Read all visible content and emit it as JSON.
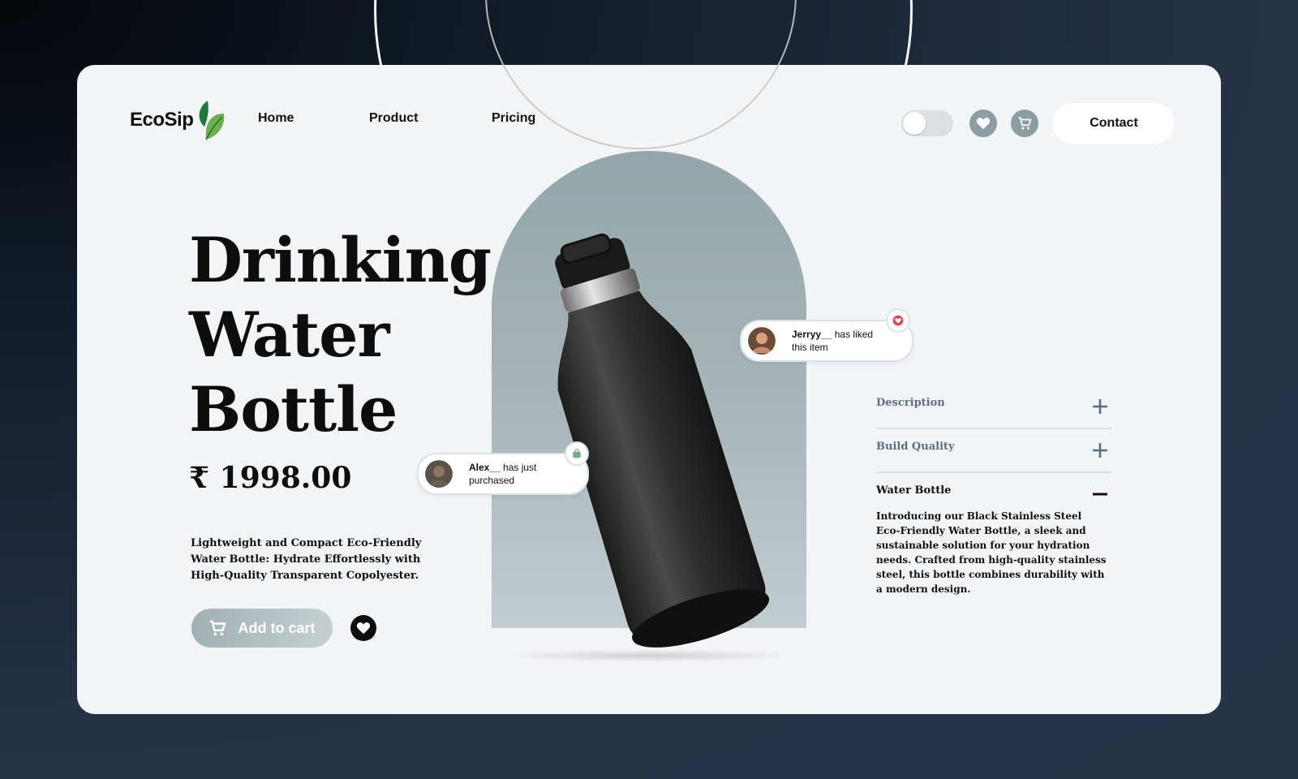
{
  "brand": {
    "name": "EcoSip"
  },
  "nav": {
    "items": [
      "Home",
      "Product",
      "Pricing"
    ]
  },
  "header": {
    "contact_label": "Contact"
  },
  "product": {
    "title_lines": [
      "Drinking",
      "Water",
      "Bottle"
    ],
    "price": "₹ 1998.00",
    "tagline": "Lightweight and Compact Eco-Friendly Water Bottle: Hydrate Effortlessly with High-Quality Transparent Copolyester.",
    "add_to_cart_label": "Add to cart"
  },
  "notifications": [
    {
      "user": "Jerryy__",
      "text": " has liked this item",
      "icon": "heart-icon"
    },
    {
      "user": "Alex__",
      "text": " has just purchased",
      "icon": "shopping-bag-icon"
    }
  ],
  "accordion": [
    {
      "label": "Description",
      "expanded": false
    },
    {
      "label": "Build Quality",
      "expanded": false
    },
    {
      "label": "Water Bottle",
      "expanded": true,
      "body": "Introducing our Black Stainless Steel Eco-Friendly Water Bottle, a sleek and sustainable solution for your hydration needs. Crafted from high-quality stainless steel, this bottle combines durability with a modern design."
    }
  ],
  "colors": {
    "accent": "#8a9da2",
    "arch": "#93a6a9",
    "accordion_label": "#5a6f87",
    "like_badge": "#e0455a",
    "bag_badge": "#7aa88e"
  }
}
